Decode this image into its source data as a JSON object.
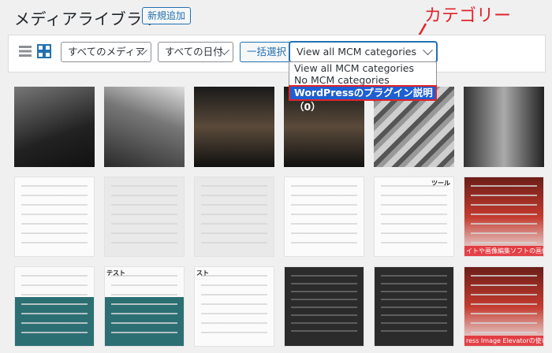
{
  "header": {
    "title": "メディアライブラリ",
    "add_new": "新規追加",
    "annotation": "カテゴリー"
  },
  "toolbar": {
    "media_filter": "すべてのメディア",
    "date_filter": "すべての日付",
    "bulk_select": "一括選択",
    "mcm_filter": "View all MCM categories"
  },
  "mcm_dropdown": {
    "options": [
      "View all MCM categories",
      "No MCM categories",
      "WordPressのプラグイン説明（0）"
    ],
    "selected_index": 2
  },
  "tiles": {
    "t6_label": "ツール",
    "t12_caption": "イトや画像編集ソフトの画像を / でWordPress記事に画像挿入 / ress Image Elevatorの使い方",
    "t14_label": "テスト",
    "t15_label": "スト",
    "t18_caption": "ress Image Elevatorの使い方"
  },
  "colors": {
    "accent": "#2271b1",
    "annotation": "#e0242b",
    "highlight": "#1e5fd1"
  }
}
